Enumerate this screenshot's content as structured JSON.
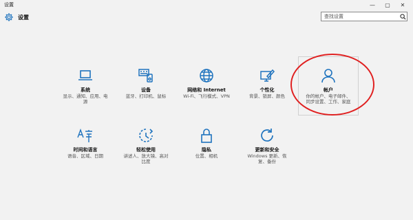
{
  "window": {
    "title": "设置",
    "minimize_glyph": "—",
    "maximize_glyph": "▢",
    "close_glyph": "✕"
  },
  "header": {
    "title": "设置",
    "search_placeholder": "查找设置"
  },
  "tiles": [
    {
      "label": "系统",
      "desc": "显示、通知、应用、电源",
      "icon": "laptop-icon"
    },
    {
      "label": "设备",
      "desc": "蓝牙、打印机、鼠标",
      "icon": "devices-icon"
    },
    {
      "label": "网络和 Internet",
      "desc": "Wi-Fi、飞行模式、VPN",
      "icon": "globe-icon"
    },
    {
      "label": "个性化",
      "desc": "背景、锁屏、颜色",
      "icon": "personalization-icon"
    },
    {
      "label": "帐户",
      "desc": "你的帐户、电子邮件、同步设置、工作、家庭",
      "icon": "person-icon"
    },
    {
      "label": "时间和语言",
      "desc": "语音、区域、日期",
      "icon": "time-language-icon"
    },
    {
      "label": "轻松使用",
      "desc": "讲述人、放大镜、高对比度",
      "icon": "ease-of-access-icon"
    },
    {
      "label": "隐私",
      "desc": "位置、相机",
      "icon": "lock-icon"
    },
    {
      "label": "更新和安全",
      "desc": "Windows 更新、恢复、备份",
      "icon": "update-icon"
    }
  ],
  "colors": {
    "accent": "#1e73be",
    "annotation": "#e02020",
    "background": "#f2f2f2"
  }
}
